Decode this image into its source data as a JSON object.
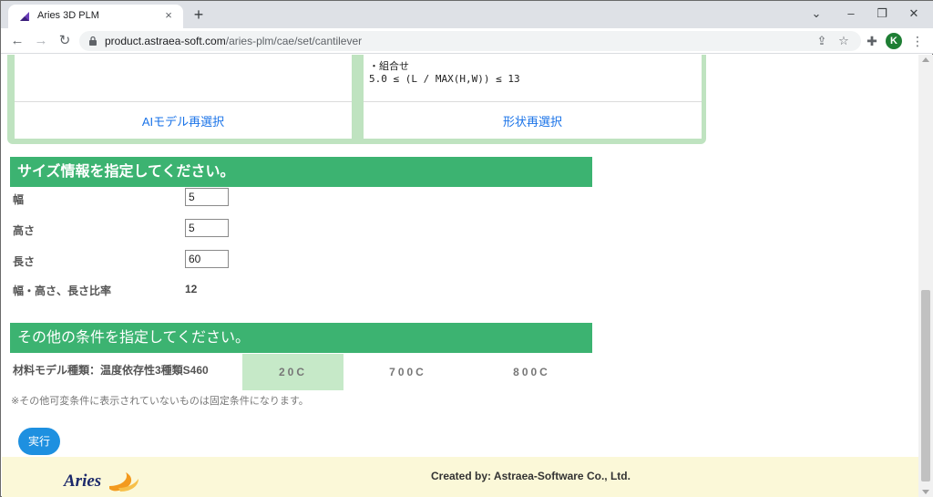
{
  "browser": {
    "tab_title": "Aries 3D PLM",
    "tab_close": "×",
    "new_tab": "+",
    "url_host": "product.astraea-soft.com",
    "url_path": "/aries-plm/cae/set/cantilever",
    "profile_initial": "K"
  },
  "cards": {
    "left_link": "AIモデル再選択",
    "right_link": "形状再選択",
    "condition_heading": "・組合せ",
    "condition_formula": "5.0 ≤ (L / MAX(H,W)) ≤ 13"
  },
  "size_section": {
    "header": "サイズ情報を指定してください。",
    "fields": [
      {
        "label": "幅",
        "value": "5"
      },
      {
        "label": "高さ",
        "value": "5"
      },
      {
        "label": "長さ",
        "value": "60"
      }
    ],
    "ratio_label": "幅・高さ、長さ比率",
    "ratio_value": "12"
  },
  "other_section": {
    "header": "その他の条件を指定してください。",
    "material_label": "材料モデル種類：温度依存性3種類S460",
    "temperatures": [
      "20C",
      "700C",
      "800C"
    ],
    "selected_temperature": "20C",
    "note": "※その他可変条件に表示されていないものは固定条件になります。"
  },
  "actions": {
    "run_label": "実行"
  },
  "footer": {
    "logo_text": "Aries",
    "credit": "Created by: Astraea-Software Co., Ltd."
  },
  "colors": {
    "section_header": "#3cb371",
    "card_border": "#bfe3c0",
    "selected_option": "#c6e9c8",
    "run_button": "#1e90e0",
    "footer_bg": "#fbf8d8",
    "link": "#1a73e8"
  }
}
